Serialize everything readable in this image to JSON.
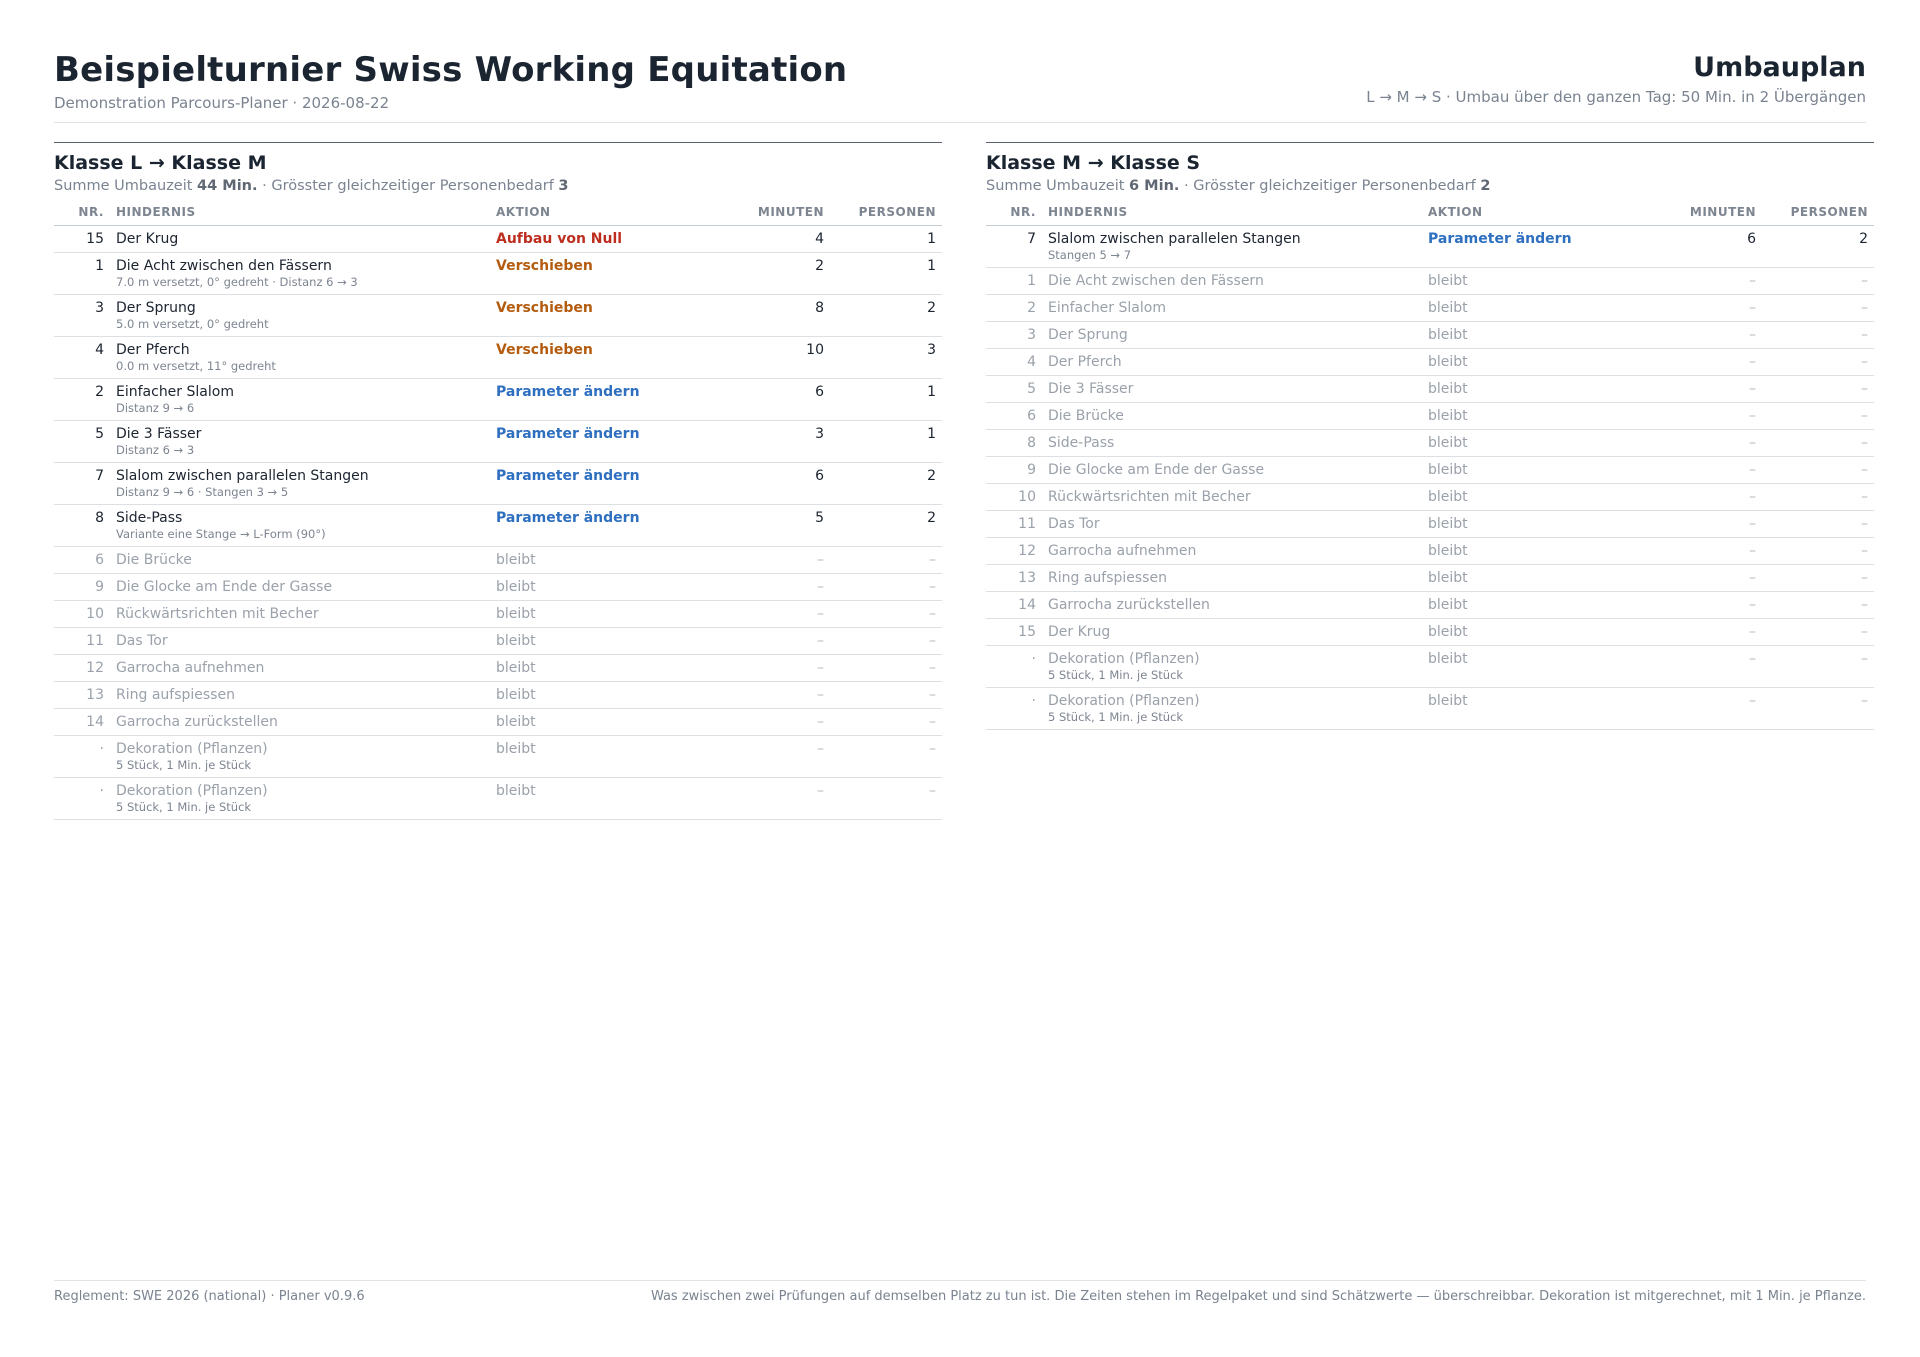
{
  "header": {
    "title": "Beispielturnier Swiss Working Equitation",
    "subtitle": "Demonstration Parcours-Planer · 2026-08-22",
    "plan_title": "Umbauplan",
    "plan_summary": "L → M → S · Umbau über den ganzen Tag: 50 Min. in 2 Übergängen"
  },
  "columns": {
    "nr": "NR.",
    "hindernis": "HINDERNIS",
    "aktion": "AKTION",
    "minuten": "MINUTEN",
    "personen": "PERSONEN"
  },
  "transitions": [
    {
      "title": "Klasse L → Klasse M",
      "summary_label1": "Summe Umbauzeit",
      "summary_value1": "44 Min.",
      "summary_label2": "· Grösster gleichzeitiger Personenbedarf",
      "summary_value2": "3",
      "rows": [
        {
          "nr": "15",
          "name": "Der Krug",
          "note": "",
          "action": "Aufbau von Null",
          "kind": "red",
          "min": "4",
          "pers": "1"
        },
        {
          "nr": "1",
          "name": "Die Acht zwischen den Fässern",
          "note": "7.0 m versetzt, 0° gedreht · Distanz 6 → 3",
          "action": "Verschieben",
          "kind": "orange",
          "min": "2",
          "pers": "1"
        },
        {
          "nr": "3",
          "name": "Der Sprung",
          "note": "5.0 m versetzt, 0° gedreht",
          "action": "Verschieben",
          "kind": "orange",
          "min": "8",
          "pers": "2"
        },
        {
          "nr": "4",
          "name": "Der Pferch",
          "note": "0.0 m versetzt, 11° gedreht",
          "action": "Verschieben",
          "kind": "orange",
          "min": "10",
          "pers": "3"
        },
        {
          "nr": "2",
          "name": "Einfacher Slalom",
          "note": "Distanz 9 → 6",
          "action": "Parameter ändern",
          "kind": "blue",
          "min": "6",
          "pers": "1"
        },
        {
          "nr": "5",
          "name": "Die 3 Fässer",
          "note": "Distanz 6 → 3",
          "action": "Parameter ändern",
          "kind": "blue",
          "min": "3",
          "pers": "1"
        },
        {
          "nr": "7",
          "name": "Slalom zwischen parallelen Stangen",
          "note": "Distanz 9 → 6 · Stangen 3 → 5",
          "action": "Parameter ändern",
          "kind": "blue",
          "min": "6",
          "pers": "2"
        },
        {
          "nr": "8",
          "name": "Side-Pass",
          "note": "Variante eine Stange → L-Form (90°)",
          "action": "Parameter ändern",
          "kind": "blue",
          "min": "5",
          "pers": "2"
        },
        {
          "nr": "6",
          "name": "Die Brücke",
          "note": "",
          "action": "bleibt",
          "kind": "stays",
          "min": "–",
          "pers": "–"
        },
        {
          "nr": "9",
          "name": "Die Glocke am Ende der Gasse",
          "note": "",
          "action": "bleibt",
          "kind": "stays",
          "min": "–",
          "pers": "–"
        },
        {
          "nr": "10",
          "name": "Rückwärtsrichten mit Becher",
          "note": "",
          "action": "bleibt",
          "kind": "stays",
          "min": "–",
          "pers": "–"
        },
        {
          "nr": "11",
          "name": "Das Tor",
          "note": "",
          "action": "bleibt",
          "kind": "stays",
          "min": "–",
          "pers": "–"
        },
        {
          "nr": "12",
          "name": "Garrocha aufnehmen",
          "note": "",
          "action": "bleibt",
          "kind": "stays",
          "min": "–",
          "pers": "–"
        },
        {
          "nr": "13",
          "name": "Ring aufspiessen",
          "note": "",
          "action": "bleibt",
          "kind": "stays",
          "min": "–",
          "pers": "–"
        },
        {
          "nr": "14",
          "name": "Garrocha zurückstellen",
          "note": "",
          "action": "bleibt",
          "kind": "stays",
          "min": "–",
          "pers": "–"
        },
        {
          "nr": "·",
          "name": "Dekoration (Pflanzen)",
          "note": "5 Stück, 1 Min. je Stück",
          "action": "bleibt",
          "kind": "stays",
          "min": "–",
          "pers": "–"
        },
        {
          "nr": "·",
          "name": "Dekoration (Pflanzen)",
          "note": "5 Stück, 1 Min. je Stück",
          "action": "bleibt",
          "kind": "stays",
          "min": "–",
          "pers": "–"
        }
      ]
    },
    {
      "title": "Klasse M → Klasse S",
      "summary_label1": "Summe Umbauzeit",
      "summary_value1": "6 Min.",
      "summary_label2": "· Grösster gleichzeitiger Personenbedarf",
      "summary_value2": "2",
      "rows": [
        {
          "nr": "7",
          "name": "Slalom zwischen parallelen Stangen",
          "note": "Stangen 5 → 7",
          "action": "Parameter ändern",
          "kind": "blue",
          "min": "6",
          "pers": "2"
        },
        {
          "nr": "1",
          "name": "Die Acht zwischen den Fässern",
          "note": "",
          "action": "bleibt",
          "kind": "stays",
          "min": "–",
          "pers": "–"
        },
        {
          "nr": "2",
          "name": "Einfacher Slalom",
          "note": "",
          "action": "bleibt",
          "kind": "stays",
          "min": "–",
          "pers": "–"
        },
        {
          "nr": "3",
          "name": "Der Sprung",
          "note": "",
          "action": "bleibt",
          "kind": "stays",
          "min": "–",
          "pers": "–"
        },
        {
          "nr": "4",
          "name": "Der Pferch",
          "note": "",
          "action": "bleibt",
          "kind": "stays",
          "min": "–",
          "pers": "–"
        },
        {
          "nr": "5",
          "name": "Die 3 Fässer",
          "note": "",
          "action": "bleibt",
          "kind": "stays",
          "min": "–",
          "pers": "–"
        },
        {
          "nr": "6",
          "name": "Die Brücke",
          "note": "",
          "action": "bleibt",
          "kind": "stays",
          "min": "–",
          "pers": "–"
        },
        {
          "nr": "8",
          "name": "Side-Pass",
          "note": "",
          "action": "bleibt",
          "kind": "stays",
          "min": "–",
          "pers": "–"
        },
        {
          "nr": "9",
          "name": "Die Glocke am Ende der Gasse",
          "note": "",
          "action": "bleibt",
          "kind": "stays",
          "min": "–",
          "pers": "–"
        },
        {
          "nr": "10",
          "name": "Rückwärtsrichten mit Becher",
          "note": "",
          "action": "bleibt",
          "kind": "stays",
          "min": "–",
          "pers": "–"
        },
        {
          "nr": "11",
          "name": "Das Tor",
          "note": "",
          "action": "bleibt",
          "kind": "stays",
          "min": "–",
          "pers": "–"
        },
        {
          "nr": "12",
          "name": "Garrocha aufnehmen",
          "note": "",
          "action": "bleibt",
          "kind": "stays",
          "min": "–",
          "pers": "–"
        },
        {
          "nr": "13",
          "name": "Ring aufspiessen",
          "note": "",
          "action": "bleibt",
          "kind": "stays",
          "min": "–",
          "pers": "–"
        },
        {
          "nr": "14",
          "name": "Garrocha zurückstellen",
          "note": "",
          "action": "bleibt",
          "kind": "stays",
          "min": "–",
          "pers": "–"
        },
        {
          "nr": "15",
          "name": "Der Krug",
          "note": "",
          "action": "bleibt",
          "kind": "stays",
          "min": "–",
          "pers": "–"
        },
        {
          "nr": "·",
          "name": "Dekoration (Pflanzen)",
          "note": "5 Stück, 1 Min. je Stück",
          "action": "bleibt",
          "kind": "stays",
          "min": "–",
          "pers": "–"
        },
        {
          "nr": "·",
          "name": "Dekoration (Pflanzen)",
          "note": "5 Stück, 1 Min. je Stück",
          "action": "bleibt",
          "kind": "stays",
          "min": "–",
          "pers": "–"
        }
      ]
    }
  ],
  "footer": {
    "left": "Reglement: SWE 2026 (national) · Planer v0.9.6",
    "right": "Was zwischen zwei Prüfungen auf demselben Platz zu tun ist. Die Zeiten stehen im Regelpaket und sind Schätzwerte — überschreibbar. Dekoration ist mitgerechnet, mit 1 Min. je Pflanze."
  },
  "colors": {
    "action_new": "#bd2e1f",
    "action_move": "#b45b0e",
    "action_param": "#2e6fc0",
    "stays_text": "#9aa1aa"
  }
}
